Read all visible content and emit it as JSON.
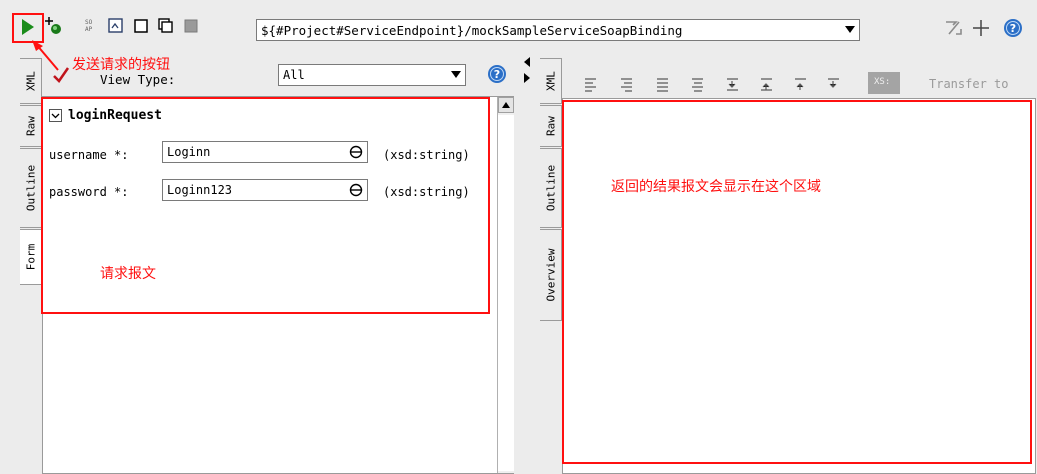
{
  "toolbar": {
    "endpoint_value": "${#Project#ServiceEndpoint}/mockSampleServiceSoapBinding",
    "icons": [
      "run-icon",
      "add-assertion-icon",
      "format-icon",
      "encode-icon",
      "window-icon",
      "tile-icon",
      "stop-icon",
      "resize-icon",
      "plus-icon",
      "help-icon"
    ]
  },
  "request": {
    "tabs": [
      "XML",
      "Raw",
      "Outline",
      "Form"
    ],
    "active_tab": "Form",
    "view_type_label": "View Type:",
    "view_type_value": "All",
    "section_title": "loginRequest",
    "fields": [
      {
        "label": "username *:",
        "value": "Loginn",
        "type": "(xsd:string)"
      },
      {
        "label": "password *:",
        "value": "Loginn123",
        "type": "(xsd:string)"
      }
    ]
  },
  "response": {
    "tabs": [
      "XML",
      "Raw",
      "Outline",
      "Overview"
    ],
    "transfer_label": "Transfer to",
    "xs_label": "XS:"
  },
  "annotations": {
    "send_button": "发送请求的按钮",
    "request_body": "请求报文",
    "response_area": "返回的结果报文会显示在这个区域"
  },
  "colors": {
    "annotation": "#ff1010",
    "run": "#1a8c1a",
    "background": "#ececec"
  }
}
